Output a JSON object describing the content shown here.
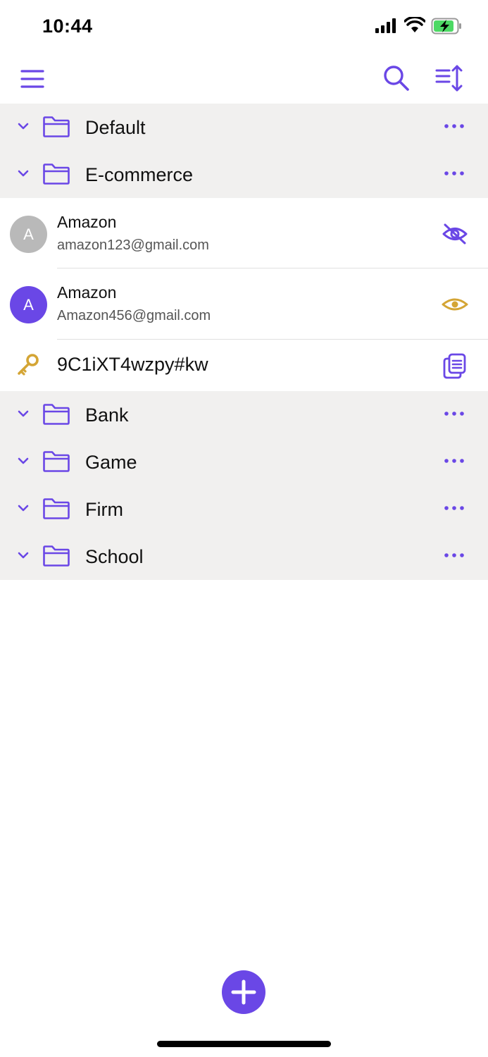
{
  "status_bar": {
    "time": "10:44"
  },
  "colors": {
    "accent": "#6a47e6",
    "gold": "#d4a535",
    "group_background": "#f1f0ef",
    "avatar_gray": "#b9b9b9",
    "battery_green": "#4cd964"
  },
  "toolbar": {
    "icons": [
      "menu-icon",
      "search-icon",
      "sort-icon"
    ]
  },
  "folders_top": [
    {
      "name": "Default"
    },
    {
      "name": "E-commerce"
    }
  ],
  "entries": [
    {
      "avatar_letter": "A",
      "title": "Amazon",
      "email": "amazon123@gmail.com",
      "visibility": "eye-slash-icon"
    },
    {
      "avatar_letter": "A",
      "title": "Amazon",
      "email": "Amazon456@gmail.com",
      "visibility": "eye-icon"
    }
  ],
  "password": {
    "value": "9C1iXT4wzpy#kw"
  },
  "folders_bottom": [
    {
      "name": "Bank"
    },
    {
      "name": "Game"
    },
    {
      "name": "Firm"
    },
    {
      "name": "School"
    }
  ]
}
